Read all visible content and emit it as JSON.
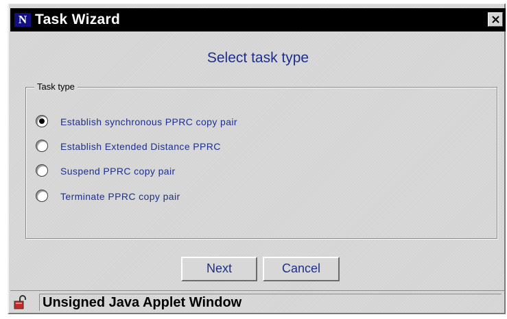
{
  "window": {
    "title": "Task Wizard",
    "logo_letter": "N"
  },
  "heading": "Select task type",
  "task_type_group": {
    "label": "Task type",
    "options": [
      {
        "label": "Establish synchronous PPRC copy pair",
        "selected": true
      },
      {
        "label": "Establish Extended Distance PPRC",
        "selected": false
      },
      {
        "label": "Suspend PPRC copy pair",
        "selected": false
      },
      {
        "label": "Terminate PPRC copy pair",
        "selected": false
      }
    ]
  },
  "buttons": {
    "next_label": "Next",
    "cancel_label": "Cancel"
  },
  "status_bar": {
    "text": "Unsigned Java Applet Window",
    "icon": "unlocked-padlock-icon"
  },
  "colors": {
    "title_bar": "#000000",
    "accent_text": "#1d2f8a",
    "background": "#d8d8d8"
  }
}
